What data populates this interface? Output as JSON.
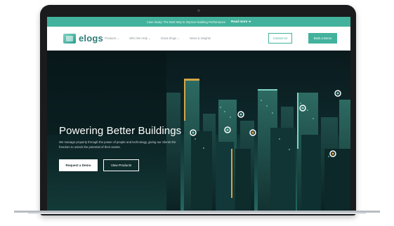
{
  "announcement": {
    "text": "Case Study: The Best Way to Improve Building Performance",
    "link": "Read more ➜"
  },
  "nav": {
    "logo_text": "elogs",
    "menu": [
      "Products ⌄",
      "Who We Help ⌄",
      "About Elogs ⌄",
      "News & Insights"
    ],
    "contact_label": "Contact Us",
    "demo_label": "Book a Demo"
  },
  "hero": {
    "title": "Powering Better Buildings",
    "subtitle": "We manage property through the power of people and technology, giving our clients the freedom to unlock the potential of their assets.",
    "primary_button": "Request a Demo",
    "secondary_button": "View Products"
  },
  "colors": {
    "accent": "#43b29c",
    "logo": "#2c7c78",
    "hero_dark": "#0d2327",
    "laptop_frame": "#1a1b1d"
  }
}
